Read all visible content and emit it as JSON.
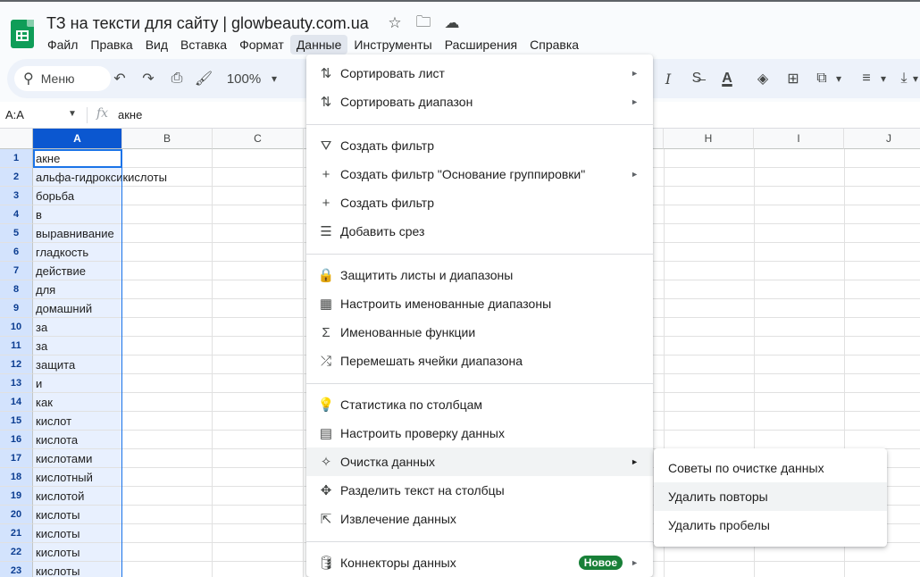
{
  "app": {
    "doc_title": "ТЗ на тексти для сайту | glowbeauty.com.ua",
    "brand_color": "#0f9d58",
    "accent_color": "#1a73e8"
  },
  "title_icons": [
    {
      "name": "star-icon",
      "glyph": "☆"
    },
    {
      "name": "move-to-folder-icon",
      "glyph": "🗀"
    },
    {
      "name": "cloud-status-icon",
      "glyph": "☁"
    }
  ],
  "menubar": [
    {
      "id": "file",
      "label": "Файл"
    },
    {
      "id": "edit",
      "label": "Правка"
    },
    {
      "id": "view",
      "label": "Вид"
    },
    {
      "id": "insert",
      "label": "Вставка"
    },
    {
      "id": "format",
      "label": "Формат"
    },
    {
      "id": "data",
      "label": "Данные",
      "active": true
    },
    {
      "id": "tools",
      "label": "Инструменты"
    },
    {
      "id": "extensions",
      "label": "Расширения"
    },
    {
      "id": "help",
      "label": "Справка"
    }
  ],
  "toolbar": {
    "search_label": "Меню",
    "zoom": "100%",
    "icons": {
      "undo": "↶",
      "redo": "↷",
      "print": "⎙",
      "paint": "🖌",
      "caret": "▾",
      "italic": "I",
      "strike": "S̶",
      "text_color": "A",
      "fill": "◈",
      "borders": "⊞",
      "merge": "⧉",
      "align": "≡",
      "valign": "⤓",
      "more": "⋮"
    }
  },
  "formula_bar": {
    "name_box": "A:A",
    "fx": "fx",
    "value": "акне"
  },
  "columns": [
    "A",
    "B",
    "C",
    "H",
    "I",
    "J"
  ],
  "rows": [
    {
      "num": "1",
      "a": "акне"
    },
    {
      "num": "2",
      "a": "альфа-гидроксикислоты"
    },
    {
      "num": "3",
      "a": "борьба"
    },
    {
      "num": "4",
      "a": "в"
    },
    {
      "num": "5",
      "a": "выравнивание"
    },
    {
      "num": "6",
      "a": "гладкость"
    },
    {
      "num": "7",
      "a": "действие"
    },
    {
      "num": "8",
      "a": "для"
    },
    {
      "num": "9",
      "a": "домашний"
    },
    {
      "num": "10",
      "a": "за"
    },
    {
      "num": "11",
      "a": "за"
    },
    {
      "num": "12",
      "a": "защита"
    },
    {
      "num": "13",
      "a": "и"
    },
    {
      "num": "14",
      "a": "как"
    },
    {
      "num": "15",
      "a": "кислот"
    },
    {
      "num": "16",
      "a": "кислота"
    },
    {
      "num": "17",
      "a": "кислотами"
    },
    {
      "num": "18",
      "a": "кислотный"
    },
    {
      "num": "19",
      "a": "кислотой"
    },
    {
      "num": "20",
      "a": "кислоты"
    },
    {
      "num": "21",
      "a": "кислоты"
    },
    {
      "num": "22",
      "a": "кислоты"
    },
    {
      "num": "23",
      "a": "кислоты"
    }
  ],
  "data_menu": {
    "items": [
      {
        "name": "sort-sheet",
        "icon": "⇅",
        "icon_name": "sort-icon",
        "label": "Сортировать лист",
        "submenu": true
      },
      {
        "name": "sort-range",
        "icon": "⇅",
        "icon_name": "sort-icon",
        "label": "Сортировать диапазон",
        "submenu": true
      },
      {
        "name": "create-filter",
        "icon": "⛛",
        "icon_name": "filter-icon",
        "label": "Создать фильтр"
      },
      {
        "name": "create-filter-group",
        "icon": "+",
        "icon_name": "plus-icon",
        "label": "Создать фильтр \"Основание группировки\"",
        "submenu": true
      },
      {
        "name": "create-filter-2",
        "icon": "+",
        "icon_name": "plus-icon",
        "label": "Создать фильтр"
      },
      {
        "name": "add-slicer",
        "icon": "☰",
        "icon_name": "slicer-icon",
        "label": "Добавить срез"
      },
      {
        "name": "protect-sheets",
        "icon": "🔒",
        "icon_name": "lock-icon",
        "label": "Защитить листы и диапазоны"
      },
      {
        "name": "named-ranges",
        "icon": "▦",
        "icon_name": "named-ranges-icon",
        "label": "Настроить именованные диапазоны"
      },
      {
        "name": "named-functions",
        "icon": "Σ",
        "icon_name": "sigma-icon",
        "label": "Именованные функции"
      },
      {
        "name": "randomize-range",
        "icon": "⤮",
        "icon_name": "shuffle-icon",
        "label": "Перемешать ячейки диапазона"
      },
      {
        "name": "column-stats",
        "icon": "💡",
        "icon_name": "lightbulb-icon",
        "label": "Статистика по столбцам"
      },
      {
        "name": "data-validation",
        "icon": "▤",
        "icon_name": "validation-icon",
        "label": "Настроить проверку данных"
      },
      {
        "name": "data-cleanup",
        "icon": "✧",
        "icon_name": "magic-wand-icon",
        "label": "Очистка данных",
        "submenu": true,
        "hover": true
      },
      {
        "name": "split-text",
        "icon": "✥",
        "icon_name": "split-icon",
        "label": "Разделить текст на столбцы"
      },
      {
        "name": "data-extraction",
        "icon": "⇱",
        "icon_name": "extract-icon",
        "label": "Извлечение данных"
      },
      {
        "name": "data-connectors",
        "icon": "🛢",
        "icon_name": "database-icon",
        "label": "Коннекторы данных",
        "submenu": true,
        "badge": "Новое"
      }
    ]
  },
  "cleanup_submenu": [
    {
      "name": "cleanup-suggestions",
      "label": "Советы по очистке данных"
    },
    {
      "name": "remove-duplicates",
      "label": "Удалить повторы",
      "hover": true
    },
    {
      "name": "trim-whitespace",
      "label": "Удалить пробелы"
    }
  ]
}
